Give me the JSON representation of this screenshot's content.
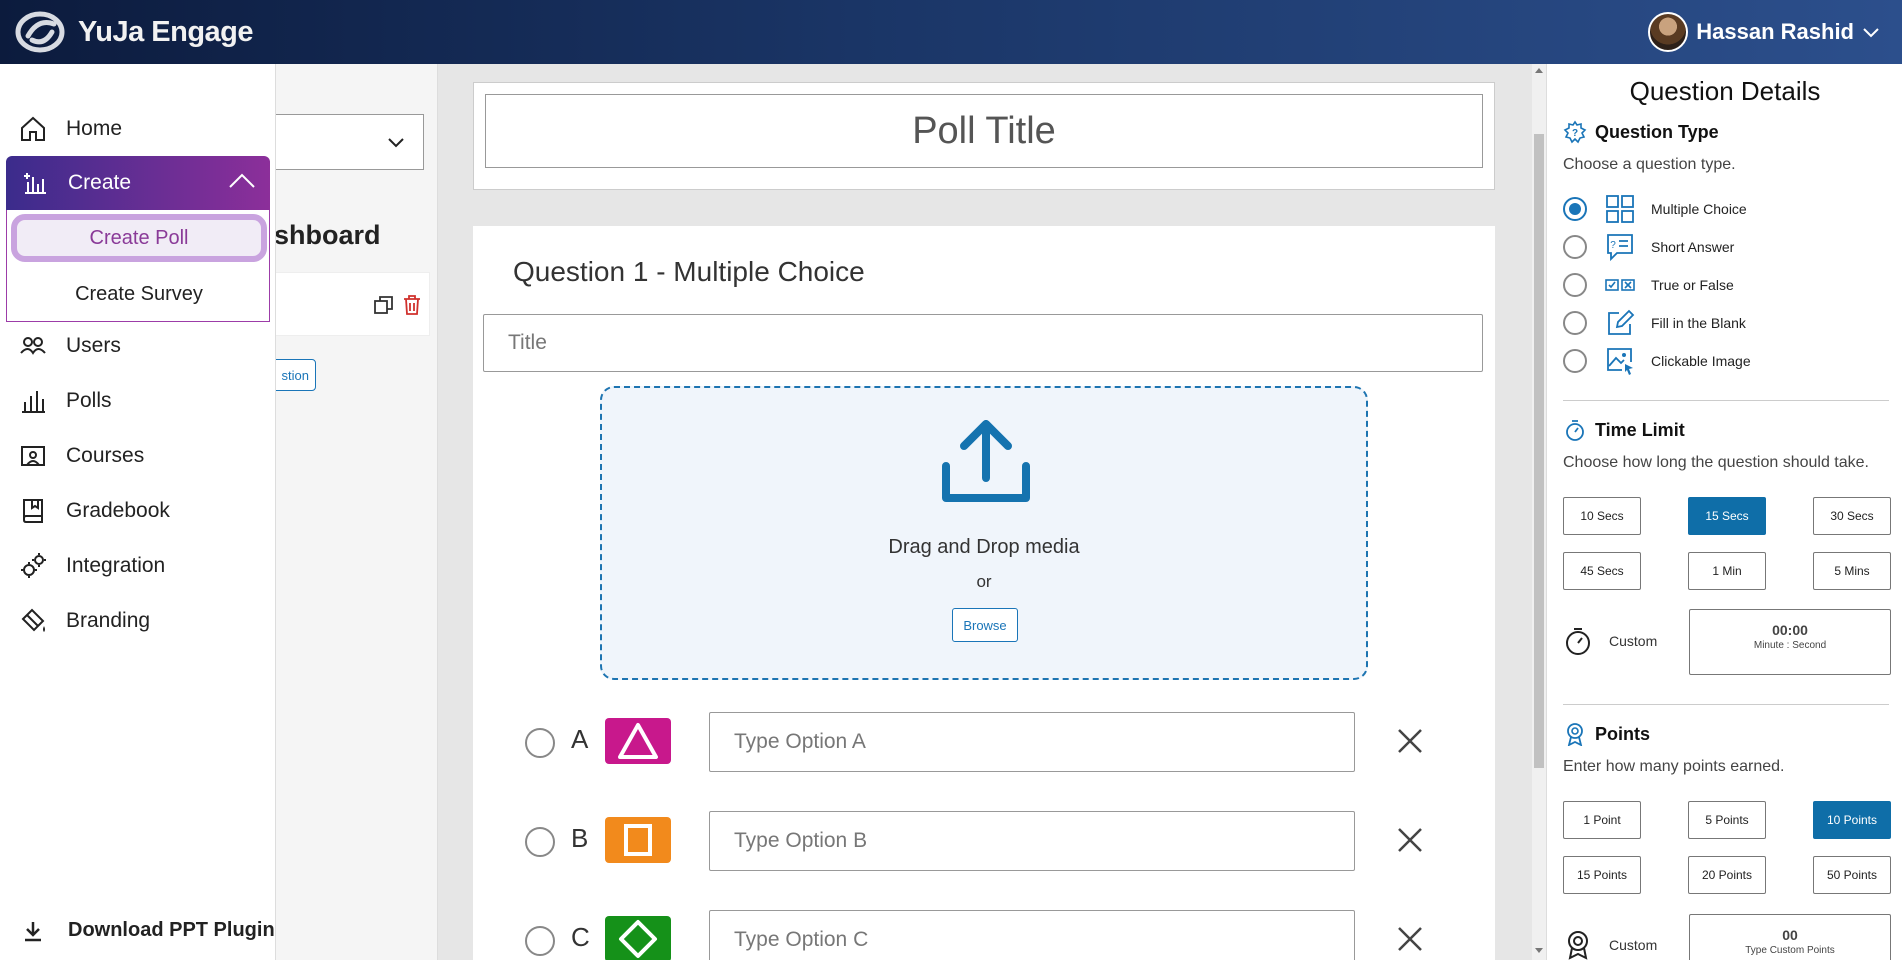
{
  "app": {
    "name": "YuJa Engage"
  },
  "user": {
    "name": "Hassan Rashid"
  },
  "nav": {
    "home": "Home",
    "create": "Create",
    "create_poll": "Create Poll",
    "create_survey": "Create Survey",
    "users": "Users",
    "polls": "Polls",
    "courses": "Courses",
    "gradebook": "Gradebook",
    "integration": "Integration",
    "branding": "Branding",
    "download": "Download PPT Plugin"
  },
  "peek": {
    "dashboard_fragment": "shboard",
    "question_btn_fragment": "stion"
  },
  "editor": {
    "poll_title": "Poll Title",
    "question_heading": "Question 1 - Multiple Choice",
    "title_placeholder": "Title",
    "drop_text": "Drag and Drop media",
    "or_text": "or",
    "browse": "Browse",
    "options": [
      {
        "letter": "A",
        "placeholder": "Type Option A",
        "color": "#c8188c",
        "shape": "triangle"
      },
      {
        "letter": "B",
        "placeholder": "Type Option B",
        "color": "#f28a1c",
        "shape": "square"
      },
      {
        "letter": "C",
        "placeholder": "Type Option C",
        "color": "#159119",
        "shape": "diamond"
      }
    ]
  },
  "details": {
    "title": "Question Details",
    "question_type": {
      "heading": "Question Type",
      "sub": "Choose a question type.",
      "types": [
        {
          "label": "Multiple Choice",
          "icon": "grid-icon",
          "selected": true
        },
        {
          "label": "Short Answer",
          "icon": "chat-question-icon",
          "selected": false
        },
        {
          "label": "True or False",
          "icon": "check-x-icon",
          "selected": false
        },
        {
          "label": "Fill in the Blank",
          "icon": "edit-icon",
          "selected": false
        },
        {
          "label": "Clickable Image",
          "icon": "image-cursor-icon",
          "selected": false
        }
      ]
    },
    "time_limit": {
      "heading": "Time Limit",
      "sub": "Choose how long the question should take.",
      "options": [
        "10 Secs",
        "15 Secs",
        "30 Secs",
        "45 Secs",
        "1 Min",
        "5 Mins"
      ],
      "selected": "15 Secs",
      "custom_label": "Custom",
      "custom_value": "00:00",
      "custom_sub": "Minute : Second"
    },
    "points": {
      "heading": "Points",
      "sub": "Enter how many points earned.",
      "options": [
        "1 Point",
        "5 Points",
        "10 Points",
        "15 Points",
        "20 Points",
        "50 Points"
      ],
      "selected": "10 Points",
      "custom_label": "Custom",
      "custom_value": "00",
      "custom_sub": "Type Custom Points"
    }
  },
  "colors": {
    "accent": "#1a75b8",
    "create_gradient_start": "#3b2c8c",
    "create_gradient_end": "#8c2f9a",
    "selected_button": "#0f6ea8"
  }
}
